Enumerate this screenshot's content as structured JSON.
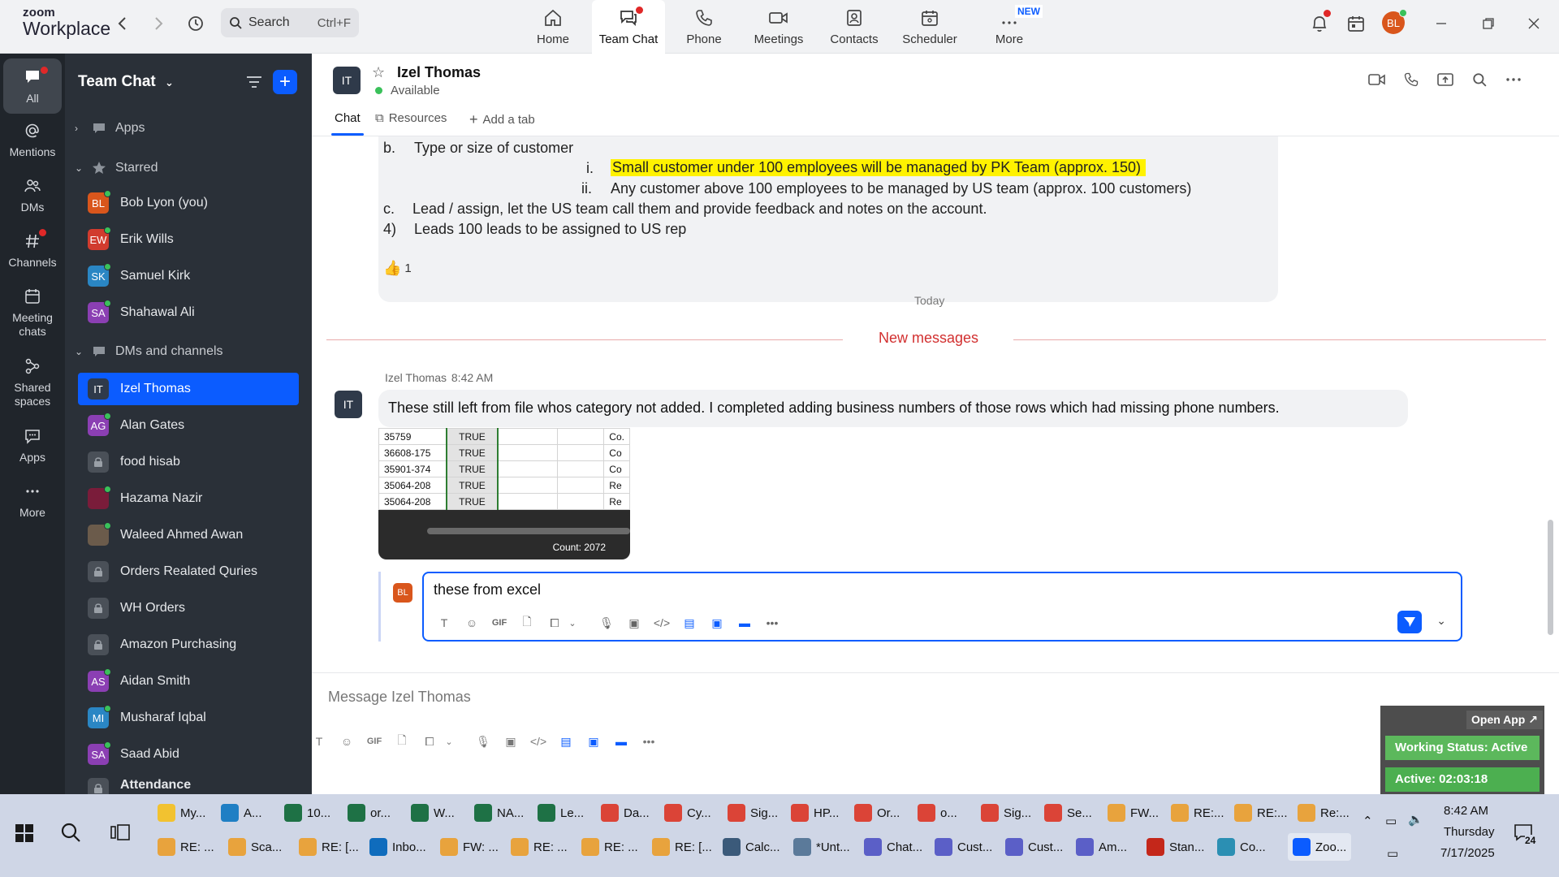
{
  "app": {
    "logo_line1": "zoom",
    "logo_line2": "Workplace",
    "search_placeholder": "Search",
    "search_shortcut": "Ctrl+F",
    "avatar_initials": "BL"
  },
  "nav_tabs": [
    {
      "label": "Home",
      "icon": "home-icon"
    },
    {
      "label": "Team Chat",
      "icon": "chat-icon",
      "active": true
    },
    {
      "label": "Phone",
      "icon": "phone-icon"
    },
    {
      "label": "Meetings",
      "icon": "video-icon"
    },
    {
      "label": "Contacts",
      "icon": "contacts-icon"
    },
    {
      "label": "Scheduler",
      "icon": "calendar-icon"
    },
    {
      "label": "More",
      "icon": "more-icon",
      "badge": "NEW"
    }
  ],
  "rail": [
    {
      "label": "All",
      "icon": "chat-bubble-icon"
    },
    {
      "label": "Mentions",
      "icon": "at-icon"
    },
    {
      "label": "DMs",
      "icon": "people-icon"
    },
    {
      "label": "Channels",
      "icon": "hash-icon"
    },
    {
      "label": "Meeting chats",
      "icon": "calendar-icon"
    },
    {
      "label": "Shared spaces",
      "icon": "share-icon"
    },
    {
      "label": "Apps",
      "icon": "apps-icon"
    },
    {
      "label": "More",
      "icon": "ellipsis-icon"
    }
  ],
  "sidebar": {
    "title": "Team Chat",
    "apps_label": "Apps",
    "starred_label": "Starred",
    "dms_label": "DMs and channels",
    "starred": [
      {
        "initials": "BL",
        "name": "Bob Lyon (you)",
        "color": "#d9561c"
      },
      {
        "initials": "EW",
        "name": "Erik Wills",
        "color": "#d13b2e"
      },
      {
        "initials": "SK",
        "name": "Samuel Kirk",
        "color": "#2a86c4"
      },
      {
        "initials": "SA",
        "name": "Shahawal Ali",
        "color": "#8b3fb3"
      }
    ],
    "items": [
      {
        "initials": "IT",
        "name": "Izel Thomas",
        "color": "#2f3a4a",
        "active": true
      },
      {
        "initials": "AG",
        "name": "Alan Gates",
        "color": "#8b3fb3"
      },
      {
        "initials": "",
        "name": "food hisab",
        "lock": true
      },
      {
        "initials": "",
        "name": "Hazama Nazir",
        "color": "#7a1c3a"
      },
      {
        "initials": "",
        "name": "Waleed Ahmed Awan",
        "color": "#6b5b4b"
      },
      {
        "initials": "",
        "name": "Orders Realated Quries",
        "lock": true
      },
      {
        "initials": "",
        "name": "WH Orders",
        "lock": true
      },
      {
        "initials": "",
        "name": "Amazon Purchasing",
        "lock": true
      },
      {
        "initials": "AS",
        "name": "Aidan Smith",
        "color": "#8b3fb3"
      },
      {
        "initials": "MI",
        "name": "Musharaf Iqbal",
        "color": "#2a86c4"
      },
      {
        "initials": "SA",
        "name": "Saad Abid",
        "color": "#8b3fb3"
      },
      {
        "initials": "",
        "name": "Attendance",
        "lock": true
      }
    ]
  },
  "chat": {
    "contact_initials": "IT",
    "contact_name": "Izel Thomas",
    "status": "Available",
    "tabs": [
      "Chat",
      "Resources",
      "Add a tab"
    ],
    "quote_lines": {
      "b_marker": "b.",
      "b_text": "Type or size of customer",
      "i_marker": "i.",
      "i_text": "Small customer under 100 employees will be managed by PK Team (approx. 150)",
      "ii_marker": "ii.",
      "ii_text": "Any customer above 100 employees to be managed by US team  (approx. 100 customers)",
      "c_marker": "c.",
      "c_text": "Lead / assign, let the US team call them and provide feedback and notes on the account.",
      "d_marker": "4)",
      "d_text": "Leads 100 leads to be assigned to US rep"
    },
    "reaction": {
      "emoji": "👍",
      "count": "1"
    },
    "today_label": "Today",
    "new_messages_label": "New messages",
    "message": {
      "sender": "Izel Thomas",
      "time": "8:42 AM",
      "text": "These still left from file whos category not added. I completed adding business numbers of those rows which had missing phone numbers."
    },
    "screenshot_rows": [
      {
        "a": "35759",
        "b": "TRUE",
        "d": "Co."
      },
      {
        "a": "36608-175",
        "b": "TRUE",
        "d": "Co"
      },
      {
        "a": "35901-374",
        "b": "TRUE",
        "d": "Co"
      },
      {
        "a": "35064-208",
        "b": "TRUE",
        "d": "Re"
      },
      {
        "a": "35064-208",
        "b": "TRUE",
        "d": "Re"
      }
    ],
    "screenshot_count": "Count: 2072",
    "reply_avatar": "BL",
    "reply_text": "these from excel",
    "message_placeholder": "Message Izel Thomas"
  },
  "widget": {
    "open_app": "Open App ↗",
    "working_status": "Working Status: Active",
    "active_time": "Active: 02:03:18"
  },
  "taskbar": {
    "row1": [
      {
        "label": "My...",
        "color": "#f2c230"
      },
      {
        "label": "A...",
        "color": "#1f7fc4"
      },
      {
        "label": "10...",
        "color": "#1e7145"
      },
      {
        "label": "or...",
        "color": "#1e7145"
      },
      {
        "label": "W...",
        "color": "#1e7145"
      },
      {
        "label": "NA...",
        "color": "#1e7145"
      },
      {
        "label": "Le...",
        "color": "#1e7145"
      },
      {
        "label": "Da...",
        "color": "#db4437"
      },
      {
        "label": "Cy...",
        "color": "#db4437"
      },
      {
        "label": "Sig...",
        "color": "#db4437"
      },
      {
        "label": "HP...",
        "color": "#db4437"
      },
      {
        "label": "Or...",
        "color": "#db4437"
      },
      {
        "label": "o...",
        "color": "#db4437"
      },
      {
        "label": "Sig...",
        "color": "#db4437"
      },
      {
        "label": "Se...",
        "color": "#db4437"
      },
      {
        "label": "FW...",
        "color": "#e8a33d"
      },
      {
        "label": "RE:...",
        "color": "#e8a33d"
      },
      {
        "label": "RE:...",
        "color": "#e8a33d"
      },
      {
        "label": "Re:...",
        "color": "#e8a33d"
      }
    ],
    "row2": [
      {
        "label": "RE: ...",
        "color": "#e8a33d"
      },
      {
        "label": "Sca...",
        "color": "#e8a33d"
      },
      {
        "label": "RE: [...",
        "color": "#e8a33d"
      },
      {
        "label": "Inbo...",
        "color": "#0f6cbd"
      },
      {
        "label": "FW: ...",
        "color": "#e8a33d"
      },
      {
        "label": "RE: ...",
        "color": "#e8a33d"
      },
      {
        "label": "RE: ...",
        "color": "#e8a33d"
      },
      {
        "label": "RE: [...",
        "color": "#e8a33d"
      },
      {
        "label": "Calc...",
        "color": "#3b5a7a"
      },
      {
        "label": "*Unt...",
        "color": "#5b7a9a"
      },
      {
        "label": "Chat...",
        "color": "#5b5fc7"
      },
      {
        "label": "Cust...",
        "color": "#5b5fc7"
      },
      {
        "label": "Cust...",
        "color": "#5b5fc7"
      },
      {
        "label": "Am...",
        "color": "#5b5fc7"
      },
      {
        "label": "Stan...",
        "color": "#c4271a"
      },
      {
        "label": "Co...",
        "color": "#2b8fb3"
      },
      {
        "label": "Zoo...",
        "color": "#0b5cff",
        "active": true
      }
    ],
    "time": "8:42 AM",
    "day": "Thursday",
    "date": "7/17/2025",
    "notif_count": "24"
  }
}
